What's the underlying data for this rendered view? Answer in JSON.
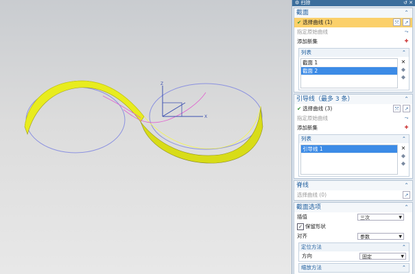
{
  "viewport": {
    "axis_x": "X",
    "axis_y": "Y",
    "axis_z": "Z",
    "surface_color": "#e8ec1e",
    "curve_color": "#8a90e0",
    "path_color": "#e060d0"
  },
  "dialog": {
    "title": "扫掠",
    "sections": {
      "label": "截面",
      "select_curve": "选择曲线 (1)",
      "specify_origin": "指定原始曲线",
      "add_new_set": "添加新集",
      "list_label": "列表",
      "items": [
        "截面 1",
        "截面 2"
      ]
    },
    "guides": {
      "label": "引导线（最多 3 条）",
      "select_curve": "选择曲线 (3)",
      "specify_origin": "指定原始曲线",
      "add_new_set": "添加新集",
      "list_label": "列表",
      "items": [
        "引导线 1"
      ]
    },
    "spine": {
      "label": "脊线",
      "select_curve": "选择曲线 (0)"
    },
    "section_options": {
      "label": "截面选项",
      "interpolation_label": "插值",
      "interpolation_value": "三次",
      "preserve_shape": "保留形状",
      "alignment_label": "对齐",
      "alignment_value": "参数",
      "orientation_method": "定位方法",
      "direction_label": "方向",
      "direction_value": "固定",
      "scaling_method": "缩放方法"
    }
  }
}
